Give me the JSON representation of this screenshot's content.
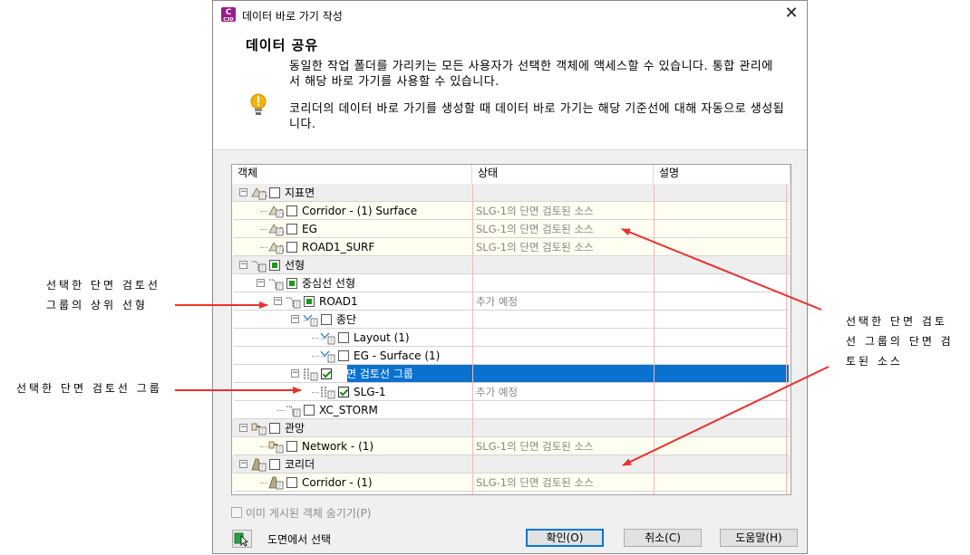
{
  "dialog": {
    "title": "데이터 바로 가기 작성",
    "app_icon": {
      "letter": "C",
      "sub": "C3D"
    },
    "close_glyph": "✕",
    "header_title": "데이터 공유",
    "header_desc": "동일한 작업 폴더를 가리키는 모든 사용자가 선택한 객체에 액세스할 수 있습니다. 통합 관리에서 해당 바로 가기를 사용할 수 있습니다.",
    "header_note": "코리더의 데이터 바로 가기를 생성할 때 데이터 바로 가기는 해당 기준선에 대해 자동으로 생성됩니다."
  },
  "tree": {
    "columns": [
      "객체",
      "상태",
      "설명"
    ],
    "rows": [
      {
        "label": "지표면",
        "status": "",
        "icon": "surface-icon",
        "checkbox": "unchecked",
        "toggle": "−",
        "group": true
      },
      {
        "label": "Corridor - (1) Surface",
        "status": "SLG-1의 단면 검토된 소스",
        "icon": "surface-icon",
        "checkbox": "unchecked"
      },
      {
        "label": "EG",
        "status": "SLG-1의 단면 검토된 소스",
        "icon": "surface-icon",
        "checkbox": "unchecked"
      },
      {
        "label": "ROAD1_SURF",
        "status": "SLG-1의 단면 검토된 소스",
        "icon": "surface-icon",
        "checkbox": "unchecked"
      },
      {
        "label": "선형",
        "status": "",
        "icon": "alignment-icon",
        "checkbox": "filled",
        "toggle": "−",
        "group": true
      },
      {
        "label": "중심선 선형",
        "status": "",
        "icon": "alignment-icon",
        "checkbox": "filled",
        "toggle": "−"
      },
      {
        "label": "ROAD1",
        "status": "추가 예정",
        "icon": "alignment-icon",
        "checkbox": "filled",
        "toggle": "−"
      },
      {
        "label": "종단",
        "status": "",
        "icon": "profile-icon",
        "checkbox": "unchecked",
        "toggle": "−"
      },
      {
        "label": "Layout (1)",
        "status": "",
        "icon": "profile-icon",
        "checkbox": "unchecked"
      },
      {
        "label": "EG - Surface (1)",
        "status": "",
        "icon": "profile-icon",
        "checkbox": "unchecked"
      },
      {
        "label": "단면 검토선 그룹",
        "status": "",
        "icon": "sample-line-group-icon",
        "checkbox": "checked",
        "toggle": "−",
        "selected": true
      },
      {
        "label": "SLG-1",
        "status": "추가 예정",
        "icon": "sample-line-group-icon",
        "checkbox": "checked"
      },
      {
        "label": "XC_STORM",
        "status": "",
        "icon": "alignment-icon",
        "checkbox": "unchecked"
      },
      {
        "label": "관망",
        "status": "",
        "icon": "pipe-network-icon",
        "checkbox": "unchecked",
        "toggle": "−",
        "group": true
      },
      {
        "label": "Network - (1)",
        "status": "SLG-1의 단면 검토된 소스",
        "icon": "pipe-network-icon",
        "checkbox": "unchecked"
      },
      {
        "label": "코리더",
        "status": "",
        "icon": "corridor-icon",
        "checkbox": "unchecked",
        "toggle": "−",
        "group": true
      },
      {
        "label": "Corridor - (1)",
        "status": "SLG-1의 단면 검토된 소스",
        "icon": "corridor-icon",
        "checkbox": "unchecked"
      }
    ]
  },
  "footer": {
    "hide_published_label": "이미 게시된 객체 숨기기(P)",
    "select_from_drawing_label": "도면에서 선택",
    "ok_label": "확인(O)",
    "cancel_label": "취소(C)",
    "help_label": "도움말(H)"
  },
  "annotations": {
    "parent_alignment": [
      "선택한 단면 검토선",
      "그룹의 상위 선형"
    ],
    "sample_line_group": "선택한 단면 검토선 그룹",
    "sampled_sources": [
      "선택한 단면 검토",
      "선 그룹의 단면 검",
      "토된 소스"
    ]
  },
  "colors": {
    "selection": "#0a71cf",
    "arrow": "#e8322f",
    "check_green": "#1a9a1a",
    "app_icon": "#9b1b8e"
  }
}
